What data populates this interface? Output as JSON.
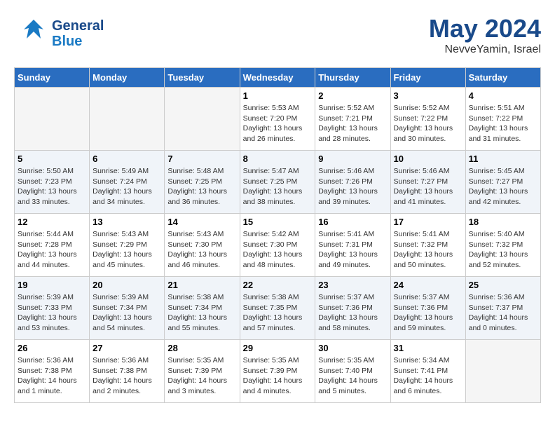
{
  "header": {
    "logo_general": "General",
    "logo_blue": "Blue",
    "month": "May 2024",
    "location": "NevveYamin, Israel"
  },
  "weekdays": [
    "Sunday",
    "Monday",
    "Tuesday",
    "Wednesday",
    "Thursday",
    "Friday",
    "Saturday"
  ],
  "weeks": [
    [
      {
        "day": "",
        "info": ""
      },
      {
        "day": "",
        "info": ""
      },
      {
        "day": "",
        "info": ""
      },
      {
        "day": "1",
        "info": "Sunrise: 5:53 AM\nSunset: 7:20 PM\nDaylight: 13 hours\nand 26 minutes."
      },
      {
        "day": "2",
        "info": "Sunrise: 5:52 AM\nSunset: 7:21 PM\nDaylight: 13 hours\nand 28 minutes."
      },
      {
        "day": "3",
        "info": "Sunrise: 5:52 AM\nSunset: 7:22 PM\nDaylight: 13 hours\nand 30 minutes."
      },
      {
        "day": "4",
        "info": "Sunrise: 5:51 AM\nSunset: 7:22 PM\nDaylight: 13 hours\nand 31 minutes."
      }
    ],
    [
      {
        "day": "5",
        "info": "Sunrise: 5:50 AM\nSunset: 7:23 PM\nDaylight: 13 hours\nand 33 minutes."
      },
      {
        "day": "6",
        "info": "Sunrise: 5:49 AM\nSunset: 7:24 PM\nDaylight: 13 hours\nand 34 minutes."
      },
      {
        "day": "7",
        "info": "Sunrise: 5:48 AM\nSunset: 7:25 PM\nDaylight: 13 hours\nand 36 minutes."
      },
      {
        "day": "8",
        "info": "Sunrise: 5:47 AM\nSunset: 7:25 PM\nDaylight: 13 hours\nand 38 minutes."
      },
      {
        "day": "9",
        "info": "Sunrise: 5:46 AM\nSunset: 7:26 PM\nDaylight: 13 hours\nand 39 minutes."
      },
      {
        "day": "10",
        "info": "Sunrise: 5:46 AM\nSunset: 7:27 PM\nDaylight: 13 hours\nand 41 minutes."
      },
      {
        "day": "11",
        "info": "Sunrise: 5:45 AM\nSunset: 7:27 PM\nDaylight: 13 hours\nand 42 minutes."
      }
    ],
    [
      {
        "day": "12",
        "info": "Sunrise: 5:44 AM\nSunset: 7:28 PM\nDaylight: 13 hours\nand 44 minutes."
      },
      {
        "day": "13",
        "info": "Sunrise: 5:43 AM\nSunset: 7:29 PM\nDaylight: 13 hours\nand 45 minutes."
      },
      {
        "day": "14",
        "info": "Sunrise: 5:43 AM\nSunset: 7:30 PM\nDaylight: 13 hours\nand 46 minutes."
      },
      {
        "day": "15",
        "info": "Sunrise: 5:42 AM\nSunset: 7:30 PM\nDaylight: 13 hours\nand 48 minutes."
      },
      {
        "day": "16",
        "info": "Sunrise: 5:41 AM\nSunset: 7:31 PM\nDaylight: 13 hours\nand 49 minutes."
      },
      {
        "day": "17",
        "info": "Sunrise: 5:41 AM\nSunset: 7:32 PM\nDaylight: 13 hours\nand 50 minutes."
      },
      {
        "day": "18",
        "info": "Sunrise: 5:40 AM\nSunset: 7:32 PM\nDaylight: 13 hours\nand 52 minutes."
      }
    ],
    [
      {
        "day": "19",
        "info": "Sunrise: 5:39 AM\nSunset: 7:33 PM\nDaylight: 13 hours\nand 53 minutes."
      },
      {
        "day": "20",
        "info": "Sunrise: 5:39 AM\nSunset: 7:34 PM\nDaylight: 13 hours\nand 54 minutes."
      },
      {
        "day": "21",
        "info": "Sunrise: 5:38 AM\nSunset: 7:34 PM\nDaylight: 13 hours\nand 55 minutes."
      },
      {
        "day": "22",
        "info": "Sunrise: 5:38 AM\nSunset: 7:35 PM\nDaylight: 13 hours\nand 57 minutes."
      },
      {
        "day": "23",
        "info": "Sunrise: 5:37 AM\nSunset: 7:36 PM\nDaylight: 13 hours\nand 58 minutes."
      },
      {
        "day": "24",
        "info": "Sunrise: 5:37 AM\nSunset: 7:36 PM\nDaylight: 13 hours\nand 59 minutes."
      },
      {
        "day": "25",
        "info": "Sunrise: 5:36 AM\nSunset: 7:37 PM\nDaylight: 14 hours\nand 0 minutes."
      }
    ],
    [
      {
        "day": "26",
        "info": "Sunrise: 5:36 AM\nSunset: 7:38 PM\nDaylight: 14 hours\nand 1 minute."
      },
      {
        "day": "27",
        "info": "Sunrise: 5:36 AM\nSunset: 7:38 PM\nDaylight: 14 hours\nand 2 minutes."
      },
      {
        "day": "28",
        "info": "Sunrise: 5:35 AM\nSunset: 7:39 PM\nDaylight: 14 hours\nand 3 minutes."
      },
      {
        "day": "29",
        "info": "Sunrise: 5:35 AM\nSunset: 7:39 PM\nDaylight: 14 hours\nand 4 minutes."
      },
      {
        "day": "30",
        "info": "Sunrise: 5:35 AM\nSunset: 7:40 PM\nDaylight: 14 hours\nand 5 minutes."
      },
      {
        "day": "31",
        "info": "Sunrise: 5:34 AM\nSunset: 7:41 PM\nDaylight: 14 hours\nand 6 minutes."
      },
      {
        "day": "",
        "info": ""
      }
    ]
  ]
}
